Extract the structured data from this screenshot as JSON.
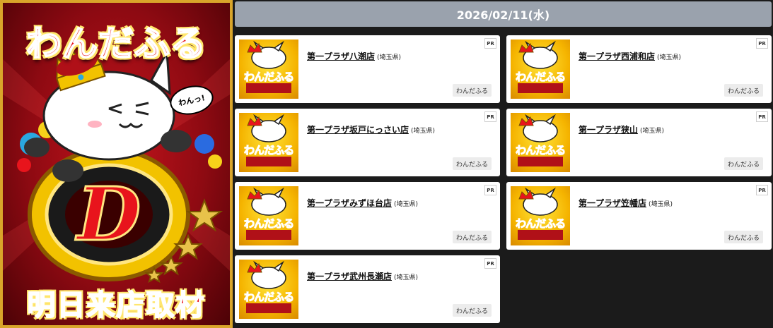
{
  "banner": {
    "title": "わんだふる",
    "subtitle": "明日来店取材",
    "bubble": "わんっ!",
    "logo_letter": "D"
  },
  "date": "2026/02/11(水)",
  "pr_label": "PR",
  "thumb_label": "わんだふる",
  "cards": [
    {
      "name": "第一プラザ八潮店",
      "pref": "(埼玉県)",
      "tag": "わんだふる"
    },
    {
      "name": "第一プラザ西浦和店",
      "pref": "(埼玉県)",
      "tag": "わんだふる"
    },
    {
      "name": "第一プラザ坂戸にっさい店",
      "pref": "(埼玉県)",
      "tag": "わんだふる"
    },
    {
      "name": "第一プラザ狭山",
      "pref": "(埼玉県)",
      "tag": "わんだふる"
    },
    {
      "name": "第一プラザみずほ台店",
      "pref": "(埼玉県)",
      "tag": "わんだふる"
    },
    {
      "name": "第一プラザ笠幡店",
      "pref": "(埼玉県)",
      "tag": "わんだふる"
    },
    {
      "name": "第一プラザ武州長瀬店",
      "pref": "(埼玉県)",
      "tag": "わんだふる"
    }
  ],
  "colors": {
    "page_bg": "#1b1b1b",
    "header_bg": "#9aa2ad",
    "banner_red": "#c4141c",
    "banner_gold": "#d9a52a",
    "thumb_yellow": "#ffe53a"
  },
  "icons": {
    "banner": "cat-crown-logo-icon",
    "thumb": "cat-thumbnail-icon"
  }
}
